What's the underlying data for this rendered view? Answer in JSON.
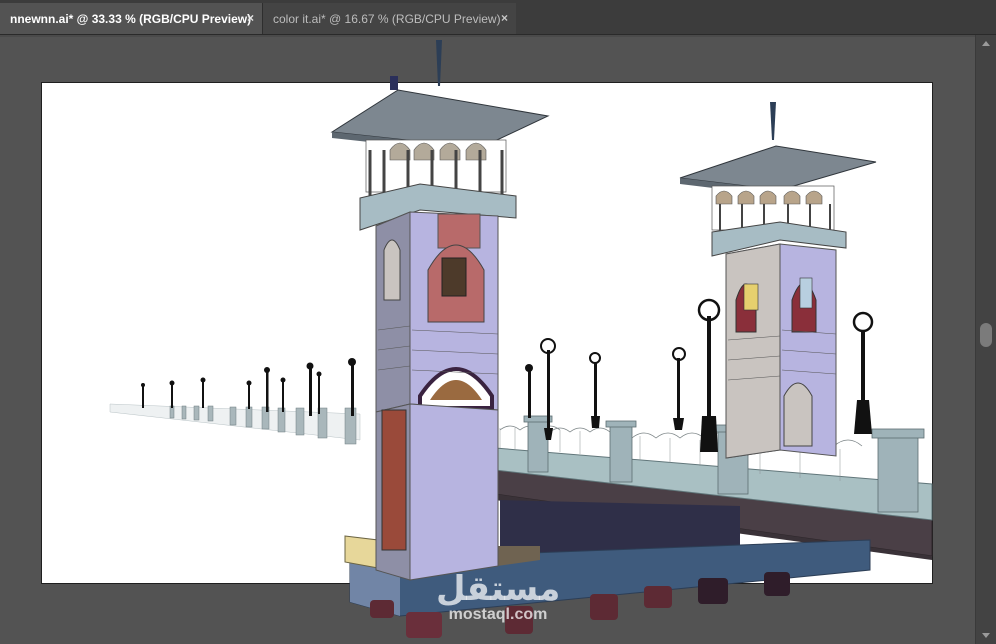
{
  "tabs": [
    {
      "label": "nnewnn.ai* @ 33.33 % (RGB/CPU Preview)",
      "close": "×",
      "active": true
    },
    {
      "label": "color it.ai* @ 16.67 % (RGB/CPU Preview)",
      "close": "×",
      "active": false
    }
  ],
  "watermark": {
    "arabic": "مستقل",
    "latin": "mostaql.com"
  },
  "colors": {
    "canvas_bg": "#535353",
    "tabbar_bg": "#3c3c3c",
    "artboard_bg": "#ffffff",
    "tower_body": "#b7b4e0",
    "tower_stone": "#8e8fa6",
    "brick_red": "#b86a6a",
    "bridge_deck": "#4a3f46",
    "railing": "#9fb3b9"
  }
}
